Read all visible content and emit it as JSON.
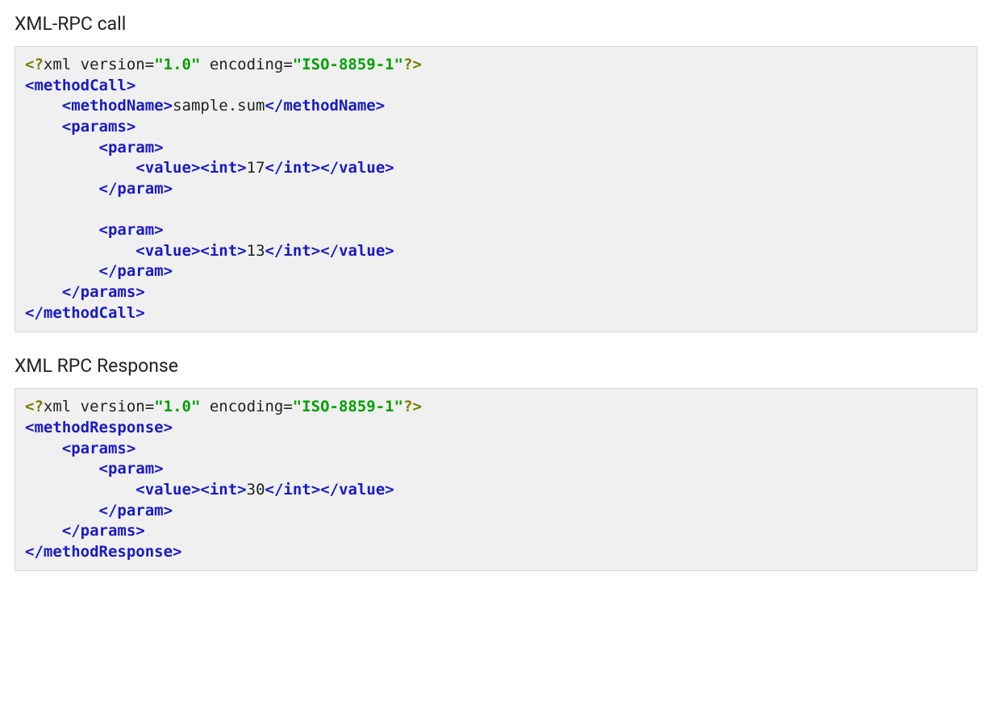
{
  "sections": {
    "call": {
      "title": "XML-RPC call"
    },
    "response": {
      "title": "XML RPC Response"
    }
  },
  "xml": {
    "pi": {
      "open": "<?",
      "close": "?>",
      "name": "xml",
      "version_attr": " version",
      "version_val": "\"1.0\"",
      "encoding_attr": " encoding",
      "encoding_val": "\"ISO-8859-1\"",
      "eq": "="
    },
    "lt": "<",
    "lts": "</",
    "gt": ">",
    "tags": {
      "methodCall": "methodCall",
      "methodResponse": "methodResponse",
      "methodName": "methodName",
      "params": "params",
      "param": "param",
      "value": "value",
      "int": "int"
    },
    "indent1": "    ",
    "indent2": "        ",
    "indent3": "            "
  },
  "callData": {
    "methodName": "sample.sum",
    "params": [
      "17",
      "13"
    ]
  },
  "responseData": {
    "params": [
      "30"
    ]
  }
}
